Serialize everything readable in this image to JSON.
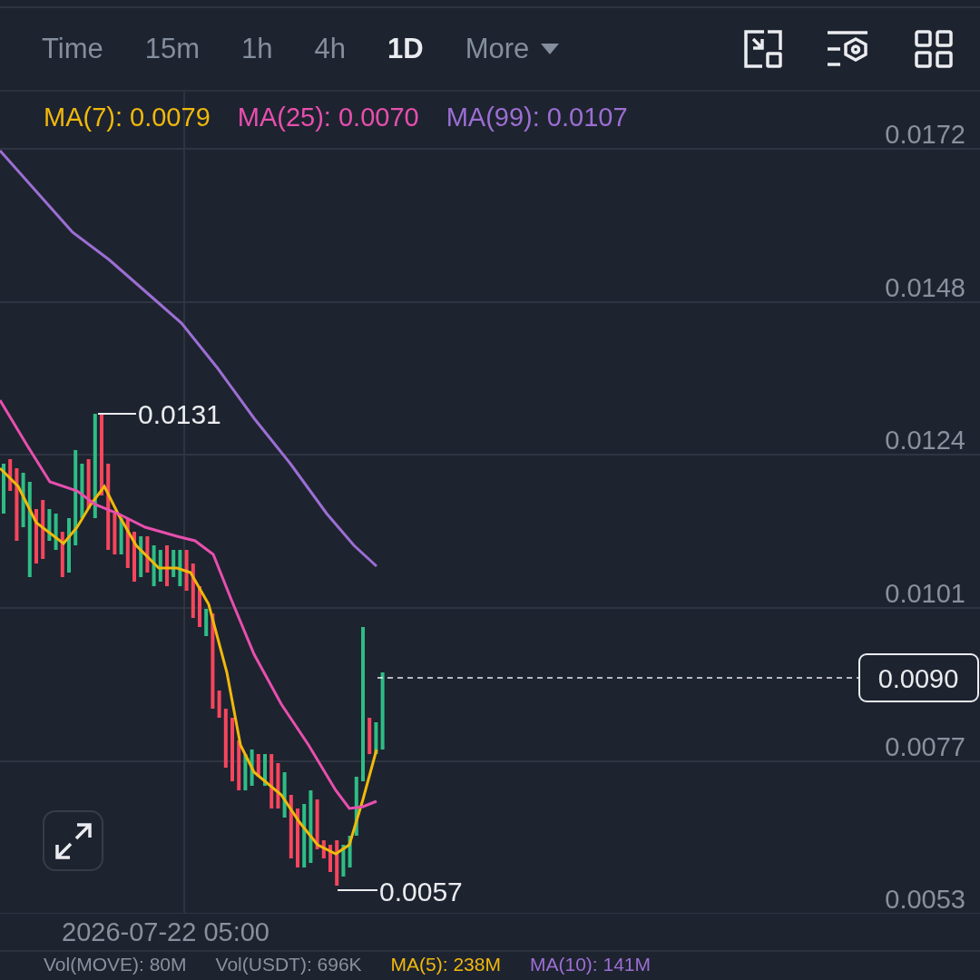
{
  "toolbar": {
    "intervals": [
      {
        "label": "Time",
        "selected": false
      },
      {
        "label": "15m",
        "selected": false
      },
      {
        "label": "1h",
        "selected": false
      },
      {
        "label": "4h",
        "selected": false
      },
      {
        "label": "1D",
        "selected": true
      }
    ],
    "more": {
      "label": "More"
    }
  },
  "ma_legend": [
    {
      "text": "MA(7): 0.0079",
      "color": "#f0b90b"
    },
    {
      "text": "MA(25): 0.0070",
      "color": "#e84fae"
    },
    {
      "text": "MA(99): 0.0107",
      "color": "#9c6fd3"
    }
  ],
  "price_axis": [
    "0.0172",
    "0.0148",
    "0.0124",
    "0.0101",
    "0.0077",
    "0.0053"
  ],
  "high_marker": "0.0131",
  "low_marker": "0.0057",
  "last_price": "0.0090",
  "time_axis": "2026-07-22 05:00",
  "volume_legend": [
    {
      "text": "Vol(MOVE): 80M",
      "color": "#8a909c"
    },
    {
      "text": "Vol(USDT): 696K",
      "color": "#8a909c"
    },
    {
      "text": "MA(5): 238M",
      "color": "#f0b90b"
    },
    {
      "text": "MA(10): 141M",
      "color": "#9c6fd3"
    }
  ]
}
